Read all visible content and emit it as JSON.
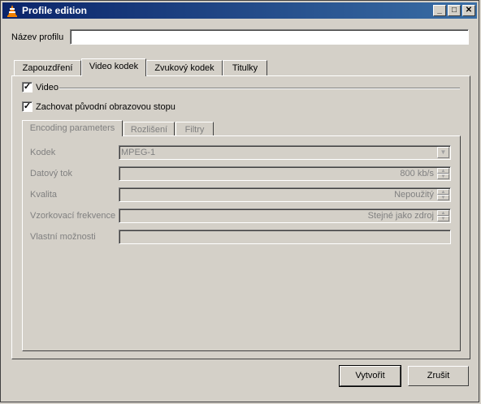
{
  "window": {
    "title": "Profile edition"
  },
  "profile": {
    "name_label": "Název profilu",
    "name_value": ""
  },
  "tabs": [
    "Zapouzdření",
    "Video kodek",
    "Zvukový kodek",
    "Titulky"
  ],
  "video": {
    "video_checkbox_label": "Video",
    "video_checked": true,
    "keep_label": "Zachovat původní obrazovou stopu",
    "keep_checked": true,
    "subtabs": [
      "Encoding parameters",
      "Rozlišení",
      "Filtry"
    ],
    "codec_label": "Kodek",
    "codec_value": "MPEG-1",
    "bitrate_label": "Datový tok",
    "bitrate_value": "800 kb/s",
    "quality_label": "Kvalita",
    "quality_value": "Nepoužitý",
    "framerate_label": "Vzorkovací frekvence",
    "framerate_value": "Stejné jako zdroj",
    "custom_label": "Vlastní možnosti",
    "custom_value": ""
  },
  "buttons": {
    "create": "Vytvořit",
    "cancel": "Zrušit"
  },
  "icons": {
    "app": "vlc-cone-icon"
  },
  "colors": {
    "titlebar": "#0a246a",
    "face": "#d4d0c8"
  }
}
